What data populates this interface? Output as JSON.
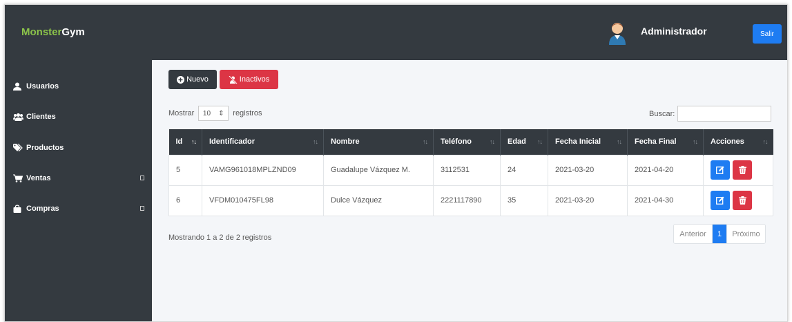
{
  "brand": {
    "part1": "Monster",
    "part2": "Gym"
  },
  "header": {
    "user_name": "Administrador",
    "logout_label": "Salir"
  },
  "sidebar": {
    "items": [
      {
        "label": "Usuarios",
        "icon": "user-icon"
      },
      {
        "label": "Clientes",
        "icon": "users-icon"
      },
      {
        "label": "Productos",
        "icon": "tags-icon"
      },
      {
        "label": "Ventas",
        "icon": "cart-icon"
      },
      {
        "label": "Compras",
        "icon": "bag-icon"
      }
    ]
  },
  "toolbar": {
    "new_label": "Nuevo",
    "inactive_label": "Inactivos"
  },
  "table_controls": {
    "show_label": "Mostrar",
    "page_size": "10",
    "records_label": "registros",
    "search_label": "Buscar:"
  },
  "table": {
    "headers": [
      "Id",
      "Identificador",
      "Nombre",
      "Teléfono",
      "Edad",
      "Fecha Inicial",
      "Fecha Final",
      "Acciones"
    ],
    "rows": [
      [
        "5",
        "VAMG961018MPLZND09",
        "Guadalupe Vázquez M.",
        "3112531",
        "24",
        "2021-03-20",
        "2021-04-20"
      ],
      [
        "6",
        "VFDM010475FL98",
        "Dulce Vázquez",
        "2221117890",
        "35",
        "2021-03-20",
        "2021-04-30"
      ]
    ]
  },
  "footer": {
    "info": "Mostrando 1 a 2 de 2 registros",
    "prev_label": "Anterior",
    "page": "1",
    "next_label": "Próximo"
  },
  "colors": {
    "dark": "#343a40",
    "primary": "#1e7cf2",
    "danger": "#dc3545",
    "brand_green": "#8bc34a"
  }
}
